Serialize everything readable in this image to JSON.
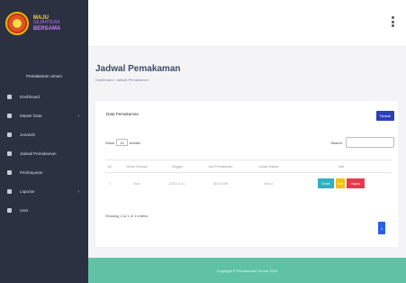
{
  "brand": {
    "line1": "MAJU",
    "line2": "SEJAHTERA",
    "line3": "BERSAMA"
  },
  "sidebar": {
    "heading": "Pemakaman Umum",
    "items": [
      {
        "label": "Dashboard",
        "icon": "dashboard-icon",
        "caret": false
      },
      {
        "label": "Master Data",
        "icon": "database-icon",
        "caret": true
      },
      {
        "label": "Jenazah",
        "icon": "user-icon",
        "caret": false
      },
      {
        "label": "Jadwal Pemakaman",
        "icon": "calendar-icon",
        "caret": false
      },
      {
        "label": "Pembayaran",
        "icon": "money-icon",
        "caret": false
      },
      {
        "label": "Laporan",
        "icon": "report-icon",
        "caret": true
      },
      {
        "label": "User",
        "icon": "users-icon",
        "caret": false
      }
    ]
  },
  "page": {
    "title": "Jadwal Pemakaman",
    "breadcrumb": "Dashboard / Jadwal Pemakaman"
  },
  "card": {
    "title": "Data Pemakaman",
    "add_button": "Tambah",
    "show_label": "Show",
    "show_value": "10",
    "entries_label": "entries",
    "search_label": "Search:",
    "search_value": ""
  },
  "table": {
    "headers": [
      "No",
      "Nama Jenazah",
      "Tanggal",
      "Jam Pemakaman",
      "Lokasi Makam",
      "Aksi"
    ],
    "rows": [
      [
        "1",
        "Budi",
        "2023-01-11",
        "08:00 WIB",
        "Blok A",
        ""
      ]
    ],
    "actions": {
      "detail": "Detail",
      "edit": "Edit",
      "delete": "Hapus"
    }
  },
  "info": "Showing 1 to 1 of 1 entries",
  "pagination": {
    "current": "1"
  },
  "footer": "Copyright © Pemakaman Umum 2023",
  "colors": {
    "sidebar": "#2c3142",
    "primary": "#2a3fb8",
    "footer": "#5fc2a5",
    "detail": "#2bb3c0",
    "edit": "#f2c200",
    "delete": "#e63a4a"
  }
}
